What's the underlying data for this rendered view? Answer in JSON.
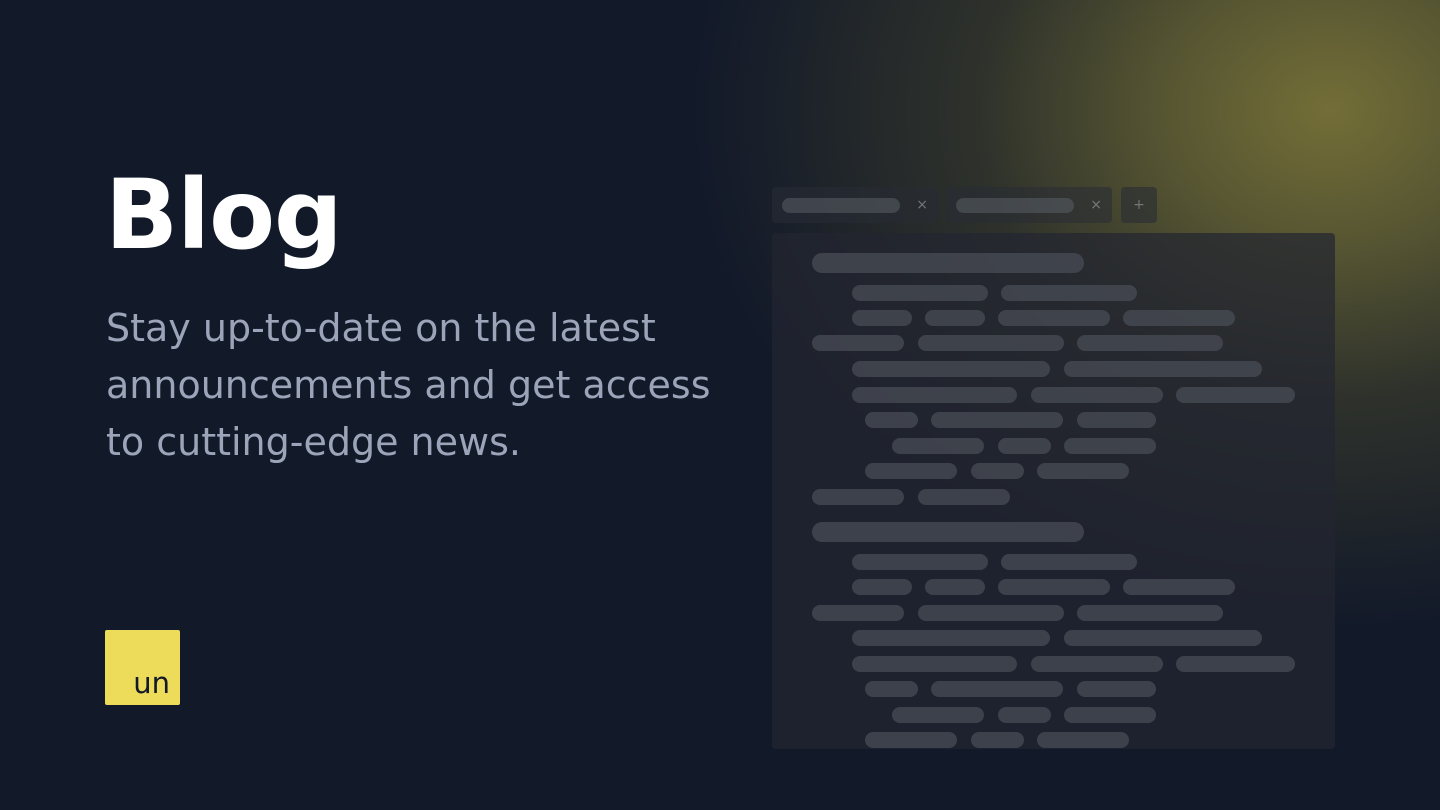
{
  "hero": {
    "title": "Blog",
    "tagline": "Stay up-to-date on the latest announcements and get access to cutting-edge news."
  },
  "logo": {
    "text": "un",
    "color": "#ecdc5a"
  },
  "editor": {
    "tabs": [
      {
        "close_glyph": "×"
      },
      {
        "close_glyph": "×"
      }
    ],
    "add_tab_glyph": "+"
  },
  "colors": {
    "background": "#121929",
    "title": "#ffffff",
    "tagline": "#9ba4b8",
    "accent": "#ecdc5a"
  }
}
